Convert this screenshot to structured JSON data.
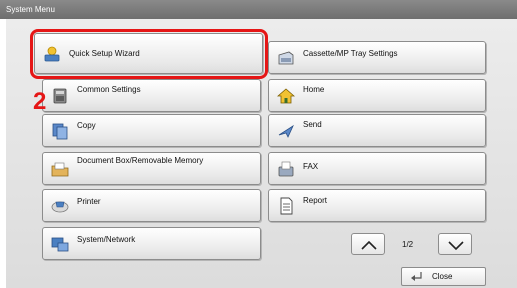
{
  "window": {
    "title": "System Menu"
  },
  "step_marker": "2",
  "left_buttons": [
    {
      "label": "Quick Setup Wizard",
      "icon": "wizard-icon"
    },
    {
      "label": "Common Settings",
      "icon": "printer-settings-icon"
    },
    {
      "label": "Copy",
      "icon": "copy-icon"
    },
    {
      "label": "Document Box/Removable Memory",
      "icon": "document-box-icon"
    },
    {
      "label": "Printer",
      "icon": "printer-icon"
    },
    {
      "label": "System/Network",
      "icon": "network-icon"
    }
  ],
  "right_buttons": [
    {
      "label": "Cassette/MP Tray Settings",
      "icon": "cassette-icon"
    },
    {
      "label": "Home",
      "icon": "home-icon"
    },
    {
      "label": "Send",
      "icon": "send-icon"
    },
    {
      "label": "FAX",
      "icon": "fax-icon"
    },
    {
      "label": "Report",
      "icon": "report-icon"
    }
  ],
  "pagination": {
    "text": "1/2"
  },
  "close_button": {
    "label": "Close"
  },
  "colors": {
    "highlight": "#e51616",
    "title_bar": "#7a7a7a"
  }
}
